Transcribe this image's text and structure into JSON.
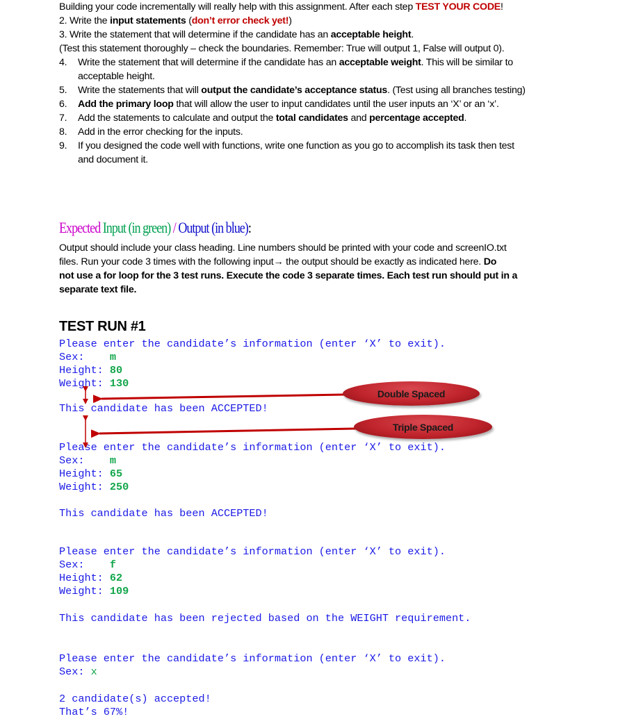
{
  "intro": {
    "line": "Building your code incrementally will really help with this assignment.  After each step ",
    "emphasis": "TEST YOUR CODE",
    "end": "!"
  },
  "steps": [
    {
      "num": "2.",
      "pre": "Write the ",
      "bold": "input statements",
      "mid": " (",
      "red": "don’t error check yet!",
      "post": ")"
    },
    {
      "num": "3.",
      "pre": "Write the statement that will determine if the candidate has an ",
      "bold": "acceptable height",
      "post": "."
    },
    {
      "note": "(Test this statement thoroughly – check the boundaries. Remember: True will output 1, False will output 0)."
    },
    {
      "num": "4.",
      "pre": "Write the statement that will determine if the candidate has an ",
      "bold": "acceptable weight",
      "post": ". This will be similar to",
      "cont": "acceptable height."
    },
    {
      "num": "5.",
      "pre": "Write the statements that will ",
      "bold": "output the candidate’s acceptance status",
      "post": ". (Test using all branches testing)"
    },
    {
      "num": "6.",
      "bold_first": "Add the primary loop",
      "post": " that will allow the user to input candidates until the user inputs an ‘X’ or an ‘x’."
    },
    {
      "num": "7.",
      "pre": "Add the statements to calculate and output the ",
      "bold": "total candidates",
      "mid": " and ",
      "bold2": "percentage accepted",
      "post": "."
    },
    {
      "num": "8.",
      "pre": "Add in the error checking for the inputs."
    },
    {
      "num": "9.",
      "pre": "If you designed the code well with functions, write one function as you go to accomplish its task then test",
      "cont": "and document it."
    }
  ],
  "expected_heading": {
    "part1": "Expected",
    "part2": " Input (in green)",
    "slash": " / ",
    "part3": "Output (in blue)",
    "colon": ":"
  },
  "instructions": {
    "line1": "Output should include your class heading. Line numbers should be printed with your code and screenIO.txt",
    "line2_pre": "files.  Run your code 3 times with the following input",
    "arrow": "→",
    "line2_post": " the output should be exactly as indicated here. ",
    "line2_bold": "Do",
    "line3_bold": "not use a for loop for the 3 test runs. Execute the code 3 separate times. Each test run should put in a",
    "line4_bold": "separate text file."
  },
  "test_run": {
    "title": "TEST RUN #1",
    "prompt": "Please enter the candidate’s information (enter ‘X’ to exit).",
    "sex_label": "Sex:    ",
    "sex_label_short": "Sex: ",
    "height_label": "Height: ",
    "weight_label": "Weight: ",
    "candidates": [
      {
        "sex": "m",
        "height": "80",
        "weight": "130",
        "result": "This candidate has been ACCEPTED!"
      },
      {
        "sex": "m",
        "height": "65",
        "weight": "250",
        "result": "This candidate has been ACCEPTED!"
      },
      {
        "sex": "f",
        "height": "62",
        "weight": "109",
        "result": "This candidate has been rejected based on the WEIGHT requirement."
      }
    ],
    "exit_input": "x",
    "summary_count": "2 candidate(s) accepted!",
    "summary_percent": "That’s 67%!"
  },
  "annotations": {
    "double": "Double Spaced",
    "triple": "Triple Spaced",
    "arrow_color": "#c00000"
  }
}
